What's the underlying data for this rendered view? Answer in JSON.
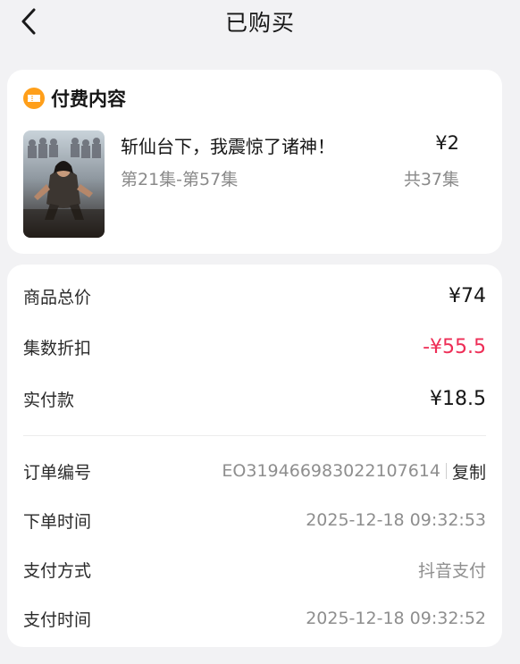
{
  "header": {
    "title": "已购买"
  },
  "content_card": {
    "section_title": "付费内容",
    "drama_title": "斩仙台下，我震惊了诸神！",
    "price": "¥2",
    "episodes": "第21集-第57集",
    "count": "共37集",
    "cover_text": "斩仙台下，我震惊了诸神！"
  },
  "summary": {
    "total_label": "商品总价",
    "total_value": "¥74",
    "discount_label": "集数折扣",
    "discount_value": "-¥55.5",
    "paid_label": "实付款",
    "paid_value": "¥18.5"
  },
  "order": {
    "number_label": "订单编号",
    "number_value": "EO319466983022107614",
    "copy_label": "复制",
    "time_label": "下单时间",
    "time_value": "2025-12-18 09:32:53",
    "method_label": "支付方式",
    "method_value": "抖音支付",
    "paytime_label": "支付时间",
    "paytime_value": "2025-12-18 09:32:52"
  },
  "colors": {
    "accent_red": "#ee2d56",
    "coupon_orange": "#ff9f1a"
  },
  "icons": {
    "back": "chevron-left-icon",
    "coupon": "coupon-icon"
  }
}
